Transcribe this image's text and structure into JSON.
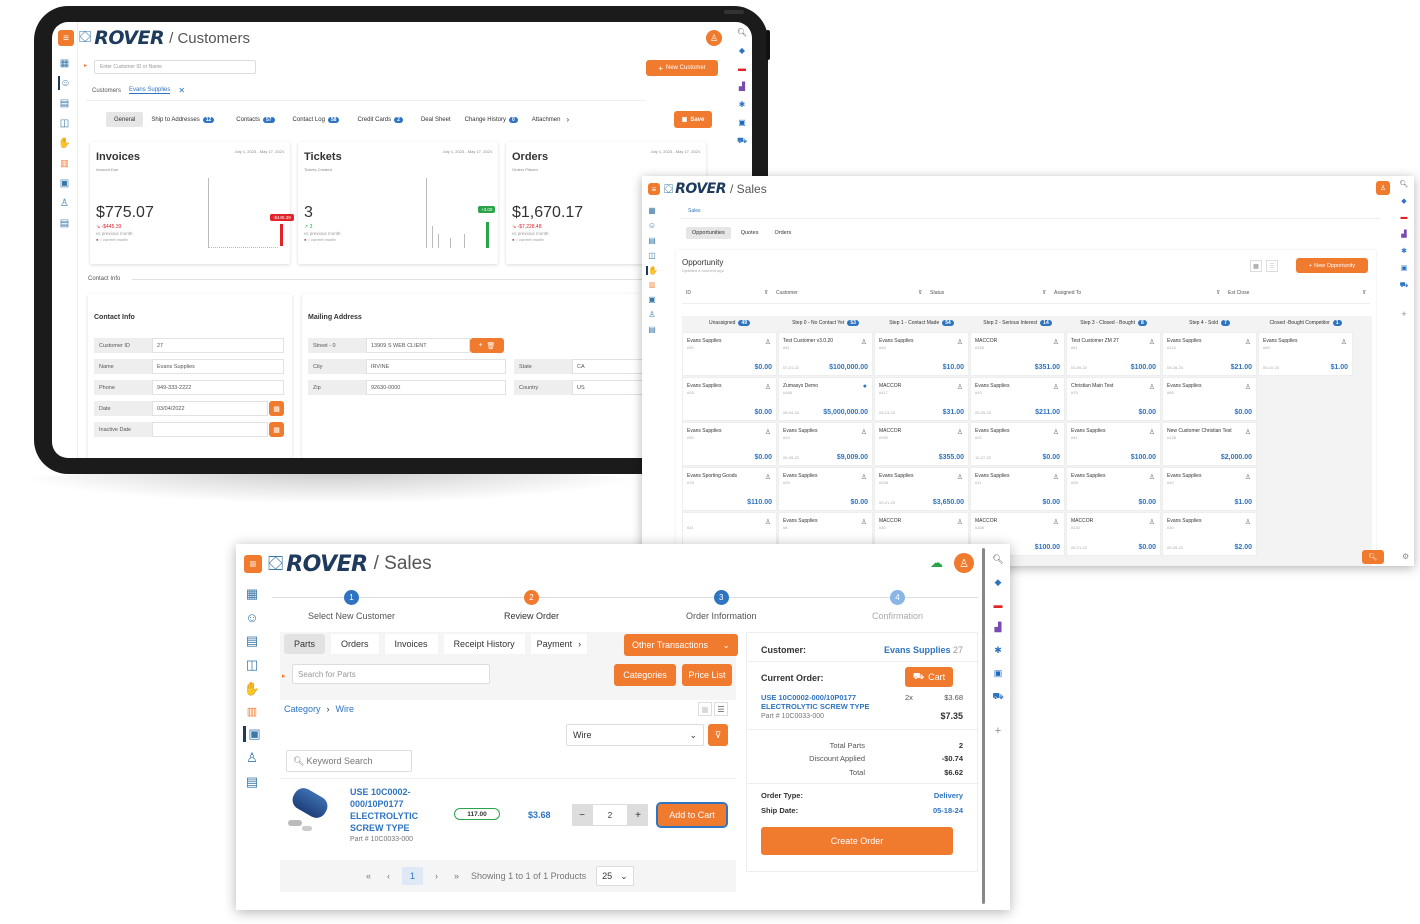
{
  "brand": "ROVER",
  "colors": {
    "accent": "#f07a2e",
    "blue": "#2f74c0",
    "green": "#2aa34a",
    "red": "#e0242a",
    "navy": "#1e3a5c"
  },
  "rail_icons": [
    "dashboard-icon",
    "customers-icon",
    "calculator-icon",
    "reports-icon",
    "sales-icon",
    "barcode-icon",
    "shipping-icon",
    "user-icon",
    "ledger-icon"
  ],
  "right_icons": [
    "search-icon",
    "tag-icon",
    "toolbox-icon",
    "chart-icon",
    "settings-icon",
    "outlook-icon",
    "cart-icon"
  ],
  "win1": {
    "title": "/ Customers",
    "search_placeholder": "Enter Customer ID or Name",
    "new_customer": "New Customer",
    "breadcrumb": {
      "root": "Customers",
      "current": "Evans Supplies"
    },
    "tabs": [
      {
        "label": "General",
        "badge": ""
      },
      {
        "label": "Ship to Addresses",
        "badge": "12"
      },
      {
        "label": "Contacts",
        "badge": "57"
      },
      {
        "label": "Contact Log",
        "badge": "58"
      },
      {
        "label": "Credit Cards",
        "badge": "2"
      },
      {
        "label": "Deal Sheet",
        "badge": ""
      },
      {
        "label": "Change History",
        "badge": "0"
      },
      {
        "label": "Attachmen",
        "badge": ""
      }
    ],
    "save": "Save",
    "kpis": [
      {
        "title": "Invoices",
        "sub": "Amount Due",
        "range": "July 1, 2023 - May 17, 2024",
        "value": "$775.07",
        "delta": "↘ -$445.39",
        "note": "vs previous month",
        "legend": "= current month",
        "flag": "-$445.39",
        "flag_color": "#e0242a",
        "delta_color": "#e0242a",
        "bar_color": "#e0242a"
      },
      {
        "title": "Tickets",
        "sub": "Tickets Created",
        "range": "July 1, 2023 - May 17, 2024",
        "value": "3",
        "delta": "↗ 3",
        "note": "vs previous month",
        "legend": "= current month",
        "flag": "+3.00",
        "flag_color": "#2aa34a",
        "delta_color": "#2aa34a",
        "bar_color": "#2aa34a"
      },
      {
        "title": "Orders",
        "sub": "Orders Placed",
        "range": "July 1, 2023 - May 17, 2024",
        "value": "$1,670.17",
        "delta": "↘ -$7,228.48",
        "note": "vs previous month",
        "legend": "= current month",
        "flag": "",
        "flag_color": "",
        "delta_color": "#e0242a",
        "bar_color": "#999"
      }
    ],
    "section_label": "Contact Info",
    "contact": {
      "title": "Contact Info",
      "rows": [
        {
          "label": "Customer ID",
          "value": "27"
        },
        {
          "label": "Name",
          "value": "Evans Supplies"
        },
        {
          "label": "Phone",
          "value": "949-333-2222"
        },
        {
          "label": "Date",
          "value": "03/04/2022"
        },
        {
          "label": "Inactive Date",
          "value": ""
        }
      ]
    },
    "mailing": {
      "title": "Mailing Address",
      "street_label": "Street - 0",
      "street": "13909 S WEB CLIENT",
      "city_label": "City",
      "city": "IRVINE",
      "zip_label": "Zip",
      "zip": "92630-0000",
      "state_label": "State",
      "state": "CA",
      "country_label": "Country",
      "country": "US"
    }
  },
  "win2": {
    "title": "/ Sales",
    "breadcrumb": "Sales",
    "tabs": [
      "Opportunities",
      "Quotes",
      "Orders"
    ],
    "panel_title": "Opportunity",
    "panel_sub": "Updated a moment ago",
    "new_btn": "New Opportunity",
    "filters": [
      "ID",
      "Customer",
      "Status",
      "Assigned To",
      "Est Close"
    ],
    "columns": [
      {
        "label": "Unassigned",
        "badge": "49"
      },
      {
        "label": "Step 0 - No Contact Yet",
        "badge": "53"
      },
      {
        "label": "Step 1 - Contact Made",
        "badge": "54"
      },
      {
        "label": "Step 2 - Serious Interest",
        "badge": "14"
      },
      {
        "label": "Step 3 - Closed - Bought",
        "badge": "8"
      },
      {
        "label": "Step 4 - Sold",
        "badge": "7"
      },
      {
        "label": "Closed -Bought Competitor",
        "badge": "1"
      },
      {
        "label": "Cl",
        "badge": ""
      }
    ],
    "cards": [
      [
        {
          "n": "Evans Supplies",
          "s": "#30",
          "d": "",
          "a": "$0.00"
        },
        {
          "n": "Evans Supplies",
          "s": "#28",
          "d": "",
          "a": "$0.00"
        },
        {
          "n": "Evans Supplies",
          "s": "#30",
          "d": "",
          "a": "$0.00"
        },
        {
          "n": "Evans Sporting Goods",
          "s": "#78",
          "d": "",
          "a": "$110.00"
        },
        {
          "n": "",
          "s": "#21",
          "d": "",
          "a": ""
        }
      ],
      [
        {
          "n": "Test Customer v3.0.20",
          "s": "#51",
          "d": "07-01-22",
          "a": "$100,000.00"
        },
        {
          "n": "Zumasys Demo",
          "s": "#168",
          "d": "06-04-24",
          "a": "$5,000,000.00"
        },
        {
          "n": "Evans Supplies",
          "s": "#14",
          "d": "09-26-22",
          "a": "$9,009.00"
        },
        {
          "n": "Evans Supplies",
          "s": "#29",
          "d": "",
          "a": "$0.00"
        },
        {
          "n": "Evans Supplies",
          "s": "#8",
          "d": "",
          "a": ""
        }
      ],
      [
        {
          "n": "Evans Supplies",
          "s": "#46",
          "d": "",
          "a": "$10.00"
        },
        {
          "n": "MACCOR",
          "s": "#117",
          "d": "09-13-23",
          "a": "$31.00"
        },
        {
          "n": "MACCOR",
          "s": "#150",
          "d": "",
          "a": "$355.00"
        },
        {
          "n": "Evans Supplies",
          "s": "#108",
          "d": "09-21-23",
          "a": "$3,650.00"
        },
        {
          "n": "MACCOR",
          "s": "#30",
          "d": "",
          "a": ""
        }
      ],
      [
        {
          "n": "MACCOR",
          "s": "#155",
          "d": "",
          "a": "$351.00"
        },
        {
          "n": "Evans Supplies",
          "s": "#43",
          "d": "09-25-23",
          "a": "$211.00"
        },
        {
          "n": "Evans Supplies",
          "s": "#22",
          "d": "10-27-22",
          "a": "$0.00"
        },
        {
          "n": "Evans Supplies",
          "s": "#11",
          "d": "",
          "a": "$0.00"
        },
        {
          "n": "MACCOR",
          "s": "#168",
          "d": "",
          "a": "$100.00"
        }
      ],
      [
        {
          "n": "Test Customer ZM 27",
          "s": "#61",
          "d": "03-09-22",
          "a": "$100.00"
        },
        {
          "n": "Christian Main Test",
          "s": "#75",
          "d": "",
          "a": "$0.00"
        },
        {
          "n": "Evans Supplies",
          "s": "#41",
          "d": "",
          "a": "$100.00"
        },
        {
          "n": "Evans Supplies",
          "s": "#28",
          "d": "",
          "a": "$0.00"
        },
        {
          "n": "MACCOR",
          "s": "#132",
          "d": "09-21-22",
          "a": "$0.00"
        }
      ],
      [
        {
          "n": "Evans Supplies",
          "s": "#124",
          "d": "09-28-23",
          "a": "$21.00"
        },
        {
          "n": "Evans Supplies",
          "s": "#55",
          "d": "",
          "a": "$0.00"
        },
        {
          "n": "New Customer Christian Test",
          "s": "#128",
          "d": "",
          "a": "$2,000.00"
        },
        {
          "n": "Evans Supplies",
          "s": "#42",
          "d": "",
          "a": "$1.00"
        },
        {
          "n": "Evans Supplies",
          "s": "#30",
          "d": "09-28-22",
          "a": "$2.00"
        }
      ],
      [
        {
          "n": "Evans Supplies",
          "s": "#90",
          "d": "09-10-23",
          "a": "$1.00"
        }
      ]
    ]
  },
  "win3": {
    "title": "/ Sales",
    "steps": [
      {
        "num": "1",
        "label": "Select New Customer"
      },
      {
        "num": "2",
        "label": "Review Order"
      },
      {
        "num": "3",
        "label": "Order Information"
      },
      {
        "num": "4",
        "label": "Confirmation"
      }
    ],
    "tabs": [
      "Parts",
      "Orders",
      "Invoices",
      "Receipt History",
      "Payment"
    ],
    "other_transactions": "Other Transactions",
    "search_placeholder": "Search for Parts",
    "categories_btn": "Categories",
    "price_list_btn": "Price List",
    "breadcrumb": {
      "root": "Category",
      "current": "Wire"
    },
    "filter_value": "Wire",
    "keyword_placeholder": "Keyword Search",
    "product": {
      "name": "USE 10C0002-000/10P0177 ELECTROLYTIC SCREW TYPE",
      "part": "Part # 10C0033-000",
      "stock": "117.00",
      "price": "$3.68",
      "qty": "2",
      "add": "Add to Cart"
    },
    "pager": {
      "page": "1",
      "showing": "Showing 1 to 1 of 1 Products",
      "per_page": "25"
    },
    "summary": {
      "customer_label": "Customer:",
      "customer": "Evans Supplies",
      "customer_id": "27",
      "current_order": "Current Order:",
      "cart": "Cart",
      "item_name": "USE 10C0002-000/10P0177 ELECTROLYTIC SCREW TYPE",
      "item_part": "Part # 10C0033-000",
      "item_qty": "2x",
      "item_unit": "$3.68",
      "item_total": "$7.35",
      "total_parts_label": "Total Parts",
      "total_parts": "2",
      "discount_label": "Discount Applied",
      "discount": "-$0.74",
      "total_label": "Total",
      "total": "$6.62",
      "order_type_label": "Order Type:",
      "order_type": "Delivery",
      "ship_date_label": "Ship Date:",
      "ship_date": "05-18-24",
      "create": "Create Order"
    }
  }
}
